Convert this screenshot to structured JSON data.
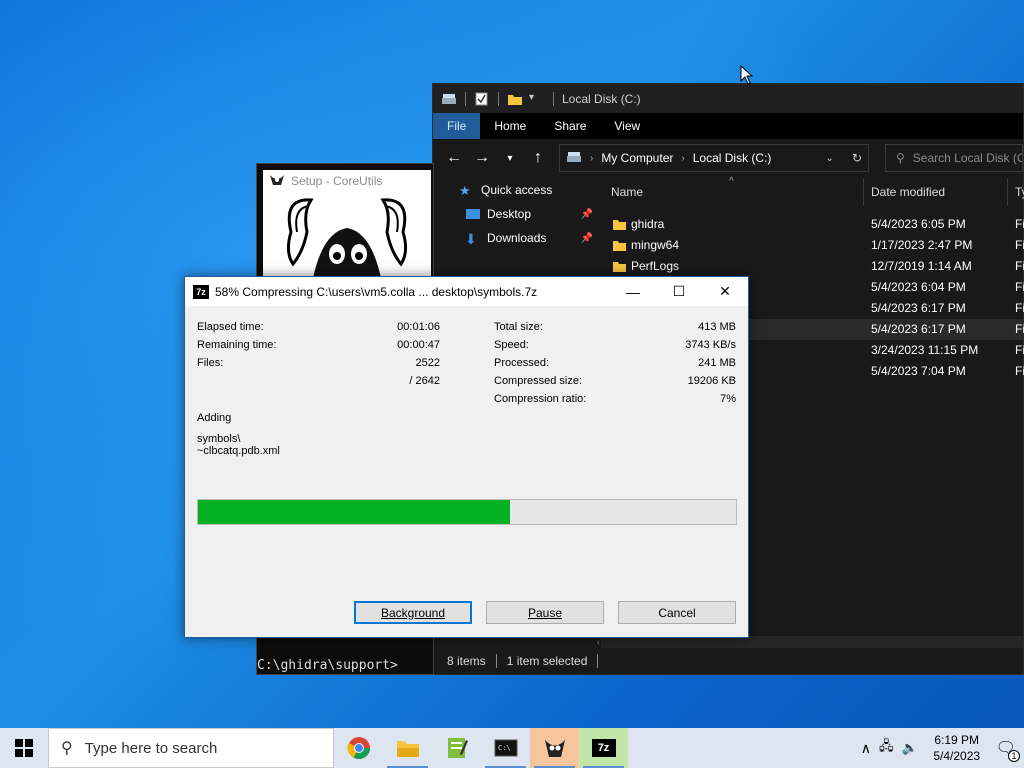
{
  "explorer": {
    "title": "Local Disk (C:)",
    "ribbon_tabs": [
      "File",
      "Home",
      "Share",
      "View"
    ],
    "address": {
      "crumb1": "My Computer",
      "crumb2": "Local Disk (C:)"
    },
    "search_placeholder": "Search Local Disk (C:)",
    "nav": {
      "quick_access": "Quick access",
      "desktop": "Desktop",
      "downloads": "Downloads"
    },
    "columns": {
      "name": "Name",
      "date": "Date modified",
      "type": "Ty"
    },
    "rows": [
      {
        "name": "ghidra",
        "date": "5/4/2023 6:05 PM",
        "type": "Fi"
      },
      {
        "name": "mingw64",
        "date": "1/17/2023 2:47 PM",
        "type": "Fi"
      },
      {
        "name": "PerfLogs",
        "date": "12/7/2019 1:14 AM",
        "type": "Fi"
      },
      {
        "name": "",
        "date": "5/4/2023 6:04 PM",
        "type": "Fi"
      },
      {
        "name": "",
        "date": "5/4/2023 6:17 PM",
        "type": "Fi"
      },
      {
        "name": "",
        "date": "5/4/2023 6:17 PM",
        "type": "Fi"
      },
      {
        "name": "",
        "date": "3/24/2023 11:15 PM",
        "type": "Fi"
      },
      {
        "name": "",
        "date": "5/4/2023 7:04 PM",
        "type": "Fi"
      }
    ],
    "status": {
      "items": "8 items",
      "selected": "1 item selected"
    }
  },
  "setup": {
    "title": "Setup - CoreUtils",
    "cmd_prompt": "C:\\ghidra\\support>"
  },
  "zip_dialog": {
    "title": "58% Compressing C:\\users\\vm5.colla ... desktop\\symbols.7z",
    "left": [
      {
        "label": "Elapsed time:",
        "value": "00:01:06"
      },
      {
        "label": "Remaining time:",
        "value": "00:00:47"
      },
      {
        "label": "Files:",
        "value": "2522"
      },
      {
        "label": "",
        "value": "/ 2642"
      }
    ],
    "right": [
      {
        "label": "Total size:",
        "value": "413 MB"
      },
      {
        "label": "Speed:",
        "value": "3743 KB/s"
      },
      {
        "label": "Processed:",
        "value": "241 MB"
      },
      {
        "label": "Compressed size:",
        "value": "19206 KB"
      },
      {
        "label": "Compression ratio:",
        "value": "7%"
      }
    ],
    "action": "Adding",
    "path_line1": "symbols\\",
    "path_line2": "~clbcatq.pdb.xml",
    "progress_fraction": 0.58,
    "buttons": {
      "background": "Background",
      "pause": "Pause",
      "cancel": "Cancel"
    }
  },
  "taskbar": {
    "search_placeholder": "Type here to search",
    "time": "6:19 PM",
    "date": "5/4/2023",
    "notification_count": "1"
  },
  "colors": {
    "progress_fill": "#06b025",
    "accent": "#0078d7",
    "desktop": "#0a6fd6"
  }
}
